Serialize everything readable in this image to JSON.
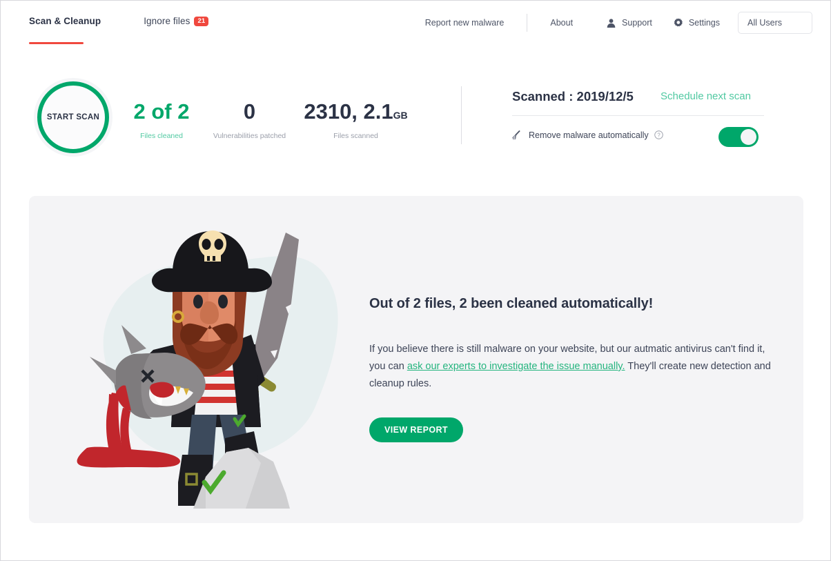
{
  "nav": {
    "tabs": [
      {
        "label": "Scan & Cleanup",
        "active": true,
        "badge": ""
      },
      {
        "label": "Ignore files",
        "active": false,
        "badge": "21"
      }
    ],
    "right_items": [
      {
        "label": "Report new malware",
        "icon": ""
      },
      {
        "label": "About",
        "icon": ""
      },
      {
        "label": "Support",
        "icon": "user-icon"
      },
      {
        "label": "Settings",
        "icon": "gear-icon"
      }
    ],
    "user_selector": "All Users"
  },
  "scan": {
    "button_label": "START SCAN",
    "stats": [
      {
        "value": "2 of 2",
        "unit": "",
        "label": "Files cleaned",
        "accent": true
      },
      {
        "value": "0",
        "unit": "",
        "label": "Vulnerabilities patched",
        "accent": false
      },
      {
        "value": "2310, 2.1",
        "unit": "GB",
        "label": "Files scanned",
        "accent": false
      }
    ]
  },
  "panel": {
    "scanned_title": "Scanned : 2019/12/5",
    "schedule_link": "Schedule next scan",
    "auto_remove_label": "Remove malware automatically",
    "auto_remove_icon": "broom-icon",
    "help_icon": "help-circle-icon",
    "toggle_state": "on"
  },
  "main": {
    "heading": "Out of 2 files, 2 been cleaned automatically!",
    "paragraph_before": "If you believe there is still malware on your website, but our autmatic antivirus can't find it, you can ",
    "paragraph_link": "ask our experts to investigate the issue manually.",
    "paragraph_after": " They'll create new detection and cleanup rules.",
    "button_label": "VIEW REPORT",
    "illustration": "pirate-with-sword-and-slain-shark-illustration"
  },
  "colors": {
    "green": "#00a76a",
    "green_light": "#51c9a2",
    "red": "#f0483e",
    "dark": "#2b3245",
    "gray": "#9b9faa",
    "card_bg": "#f4f4f6"
  }
}
